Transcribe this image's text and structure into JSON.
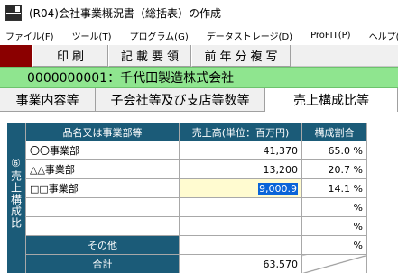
{
  "window": {
    "title": "(R04)会社事業概況書（総括表）の作成"
  },
  "menu": [
    "ファイル(F)",
    "ツール(T)",
    "プログラム(G)",
    "データストレージ(D)",
    "ProFIT(P)",
    "ヘルプ(H)"
  ],
  "toolbar": {
    "print": "印刷",
    "guide": "記載要領",
    "copy_prev": "前年分複写"
  },
  "company": {
    "label": "0000000001：千代田製造株式会社"
  },
  "tabs": [
    {
      "label": "事業内容等",
      "active": false
    },
    {
      "label": "子会社等及び支店等数等",
      "active": false
    },
    {
      "label": "売上構成比等",
      "active": true
    }
  ],
  "section": {
    "label": "⑥売上構成比"
  },
  "table": {
    "headers": [
      "品名又は事業部等",
      "売上高(単位：百万円)",
      "構成割合"
    ],
    "rows": [
      {
        "name": "〇〇事業部",
        "sales": "41,370",
        "ratio": "65.0 %"
      },
      {
        "name": "△△事業部",
        "sales": "13,200",
        "ratio": "20.7 %"
      },
      {
        "name": "□□事業部",
        "sales": "9,000.9",
        "ratio": "14.1 %"
      },
      {
        "name": "",
        "sales": "",
        "ratio": "%"
      },
      {
        "name": "",
        "sales": "",
        "ratio": "%"
      }
    ],
    "other": {
      "label": "その他",
      "sales": "",
      "ratio": "%"
    },
    "total": {
      "label": "合計",
      "sales": "63,570"
    }
  }
}
